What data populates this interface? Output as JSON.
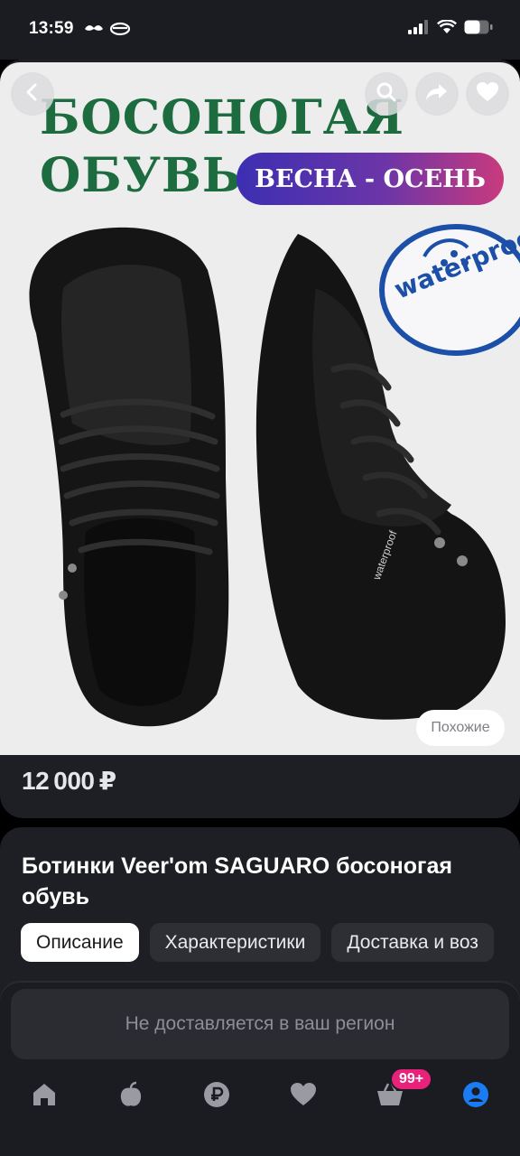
{
  "status": {
    "time": "13:59",
    "glyph_left": "❦",
    "glyph_right": "◒"
  },
  "product": {
    "image": {
      "headline_line1": "БОСОНОГАЯ",
      "headline_line2": "ОБУВЬ",
      "season": "ВЕСНА - ОСЕНЬ",
      "badge_text": "waterproof",
      "shoe_label": "waterproof"
    },
    "similar_label": "Похожие",
    "price": "12 000 ₽",
    "title": "Ботинки Veer'om SAGUARO босоногая обувь"
  },
  "tabs": [
    {
      "label": "Описание",
      "active": true
    },
    {
      "label": "Характеристики",
      "active": false
    },
    {
      "label": "Доставка и воз",
      "active": false
    }
  ],
  "region_notice": "Не доставляется в ваш регион",
  "nav": {
    "cart_badge": "99+",
    "items": [
      "home-icon",
      "catalog-icon",
      "ruble-icon",
      "heart-icon",
      "cart-icon",
      "profile-icon"
    ]
  },
  "colors": {
    "accent_active": "#1a7cf5",
    "badge": "#e8227b",
    "headline_green": "#1d6c3f"
  },
  "icons": {
    "back": "chevron-left-icon",
    "search": "search-icon",
    "share": "share-icon",
    "favorite": "heart-icon"
  }
}
